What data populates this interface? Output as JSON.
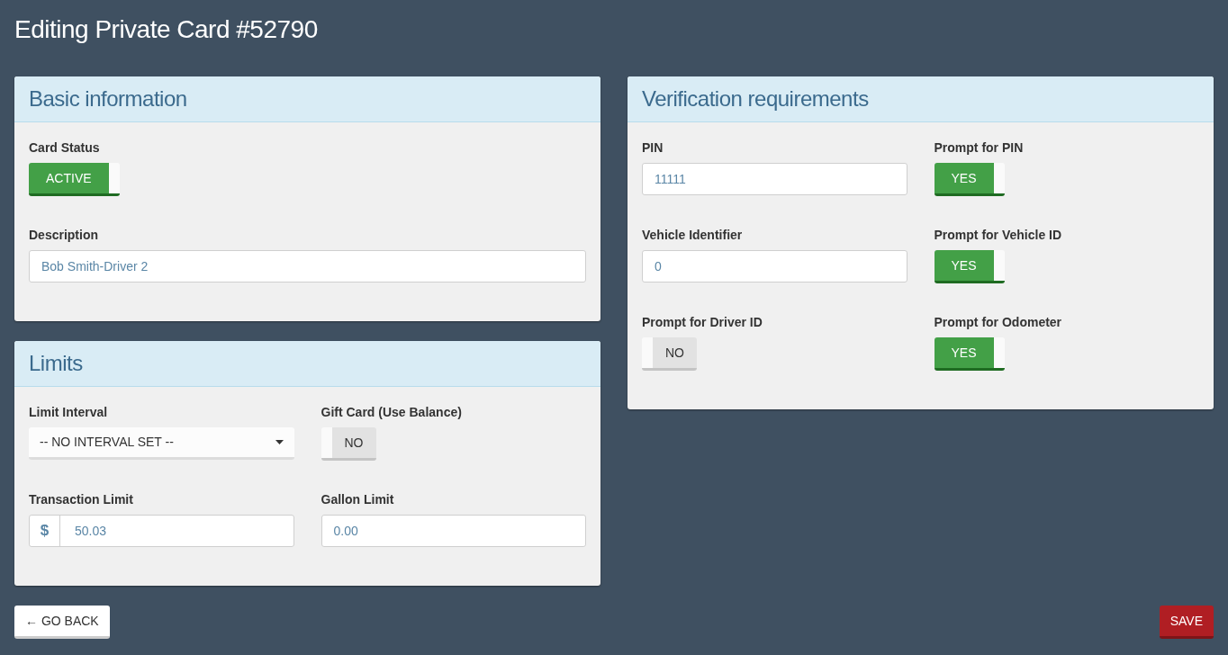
{
  "page_title": "Editing Private Card #52790",
  "left_column": [
    {
      "title": "Basic information",
      "rows": [
        [
          {
            "kind": "toggle",
            "label": "Card Status",
            "value": "ACTIVE",
            "on": true
          }
        ],
        [
          {
            "kind": "input",
            "label": "Description",
            "value": "Bob Smith-Driver 2"
          }
        ]
      ]
    },
    {
      "title": "Limits",
      "rows": [
        [
          {
            "kind": "select",
            "label": "Limit Interval",
            "value": "-- NO INTERVAL SET --"
          },
          {
            "kind": "toggle",
            "label": "Gift Card (Use Balance)",
            "value": "NO",
            "on": false
          }
        ],
        [
          {
            "kind": "money",
            "label": "Transaction Limit",
            "prefix": "$",
            "value": "50.03"
          },
          {
            "kind": "input",
            "label": "Gallon Limit",
            "value": "0.00"
          }
        ]
      ]
    }
  ],
  "right_column": [
    {
      "title": "Verification requirements",
      "rows": [
        [
          {
            "kind": "input",
            "label": "PIN",
            "value": "11111"
          },
          {
            "kind": "toggle",
            "label": "Prompt for PIN",
            "value": "YES",
            "on": true
          }
        ],
        [
          {
            "kind": "input",
            "label": "Vehicle Identifier",
            "value": "0"
          },
          {
            "kind": "toggle",
            "label": "Prompt for Vehicle ID",
            "value": "YES",
            "on": true
          }
        ],
        [
          {
            "kind": "toggle",
            "label": "Prompt for Driver ID",
            "value": "NO",
            "on": false
          },
          {
            "kind": "toggle",
            "label": "Prompt for Odometer",
            "value": "YES",
            "on": true
          }
        ]
      ]
    }
  ],
  "back_button": "← GO BACK",
  "save_button": "SAVE"
}
